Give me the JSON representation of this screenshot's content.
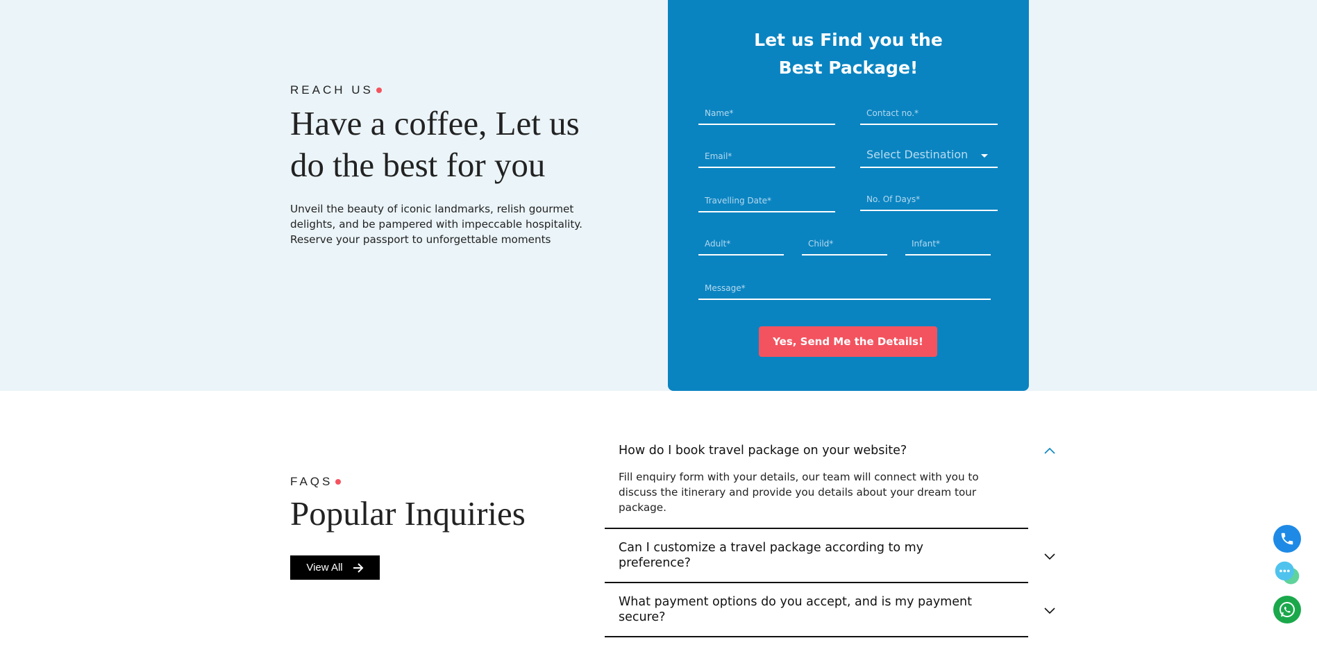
{
  "reach": {
    "eyebrow": "REACH US",
    "title": "Have a coffee, Let us do the best for you",
    "description": "Unveil the beauty of iconic landmarks, relish gourmet delights, and be pampered with impeccable hospitality. Reserve your passport to unforgettable moments"
  },
  "form": {
    "title_line1": "Let us Find you the",
    "title_line2": "Best Package!",
    "fields": {
      "name": "Name*",
      "contact": "Contact no.*",
      "email": "Email*",
      "destination": "Select Destination",
      "travel_date": "Travelling Date*",
      "days": "No. Of Days*",
      "adult": "Adult*",
      "child": "Child*",
      "infant": "Infant*",
      "message": "Message*"
    },
    "submit": "Yes, Send Me the Details!"
  },
  "faq": {
    "eyebrow": "FAQS",
    "title": "Popular Inquiries",
    "view_all": "View All",
    "items": [
      {
        "question": "How do I book travel package on your website?",
        "answer": "Fill enquiry form with your details, our team will connect with you to discuss the itinerary and provide you details about your dream tour package.",
        "expanded": true
      },
      {
        "question": "Can I customize a travel package according to my preference?",
        "expanded": false
      },
      {
        "question": "What payment options do you accept, and is my payment secure?",
        "expanded": false
      }
    ]
  },
  "colors": {
    "form_bg": "#0a84c1",
    "accent": "#f3535f",
    "section_bg": "#ebf4f8"
  },
  "icons": {
    "phone": "phone-icon",
    "chat": "chat-icon",
    "whatsapp": "whatsapp-icon"
  }
}
